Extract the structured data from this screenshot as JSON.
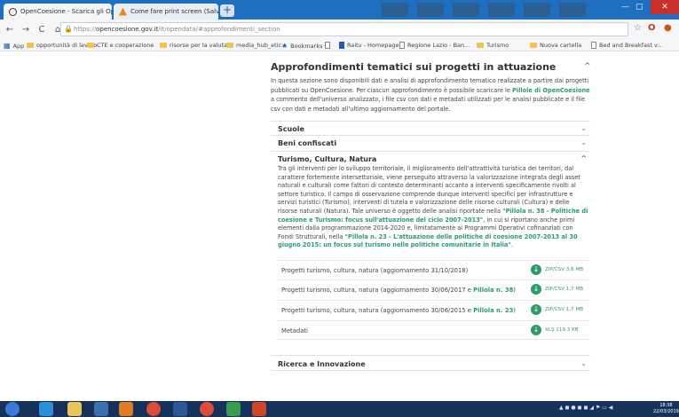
{
  "tabs": [
    {
      "title": "OpenCoesione - Scarica gli Ope"
    },
    {
      "title": "Come fare print screen (Salvatore"
    }
  ],
  "address_bar": {
    "secure_prefix": "https://",
    "domain": "opencoesione.gov.it",
    "path": "/it/opendata/#approfondimenti_section"
  },
  "bookmarks": [
    {
      "label": "App",
      "icon": "apps-icon"
    },
    {
      "label": "opportunità di lavoro",
      "icon": "folder-icon"
    },
    {
      "label": "CTE e cooperazione",
      "icon": "folder-icon"
    },
    {
      "label": "risorse per la valuta...",
      "icon": "folder-icon"
    },
    {
      "label": "media_hub_etic...",
      "icon": "folder-icon"
    },
    {
      "label": "Bookmarks",
      "icon": "star-icon"
    },
    {
      "label": "Raitv - Homepage",
      "icon": "page-icon"
    },
    {
      "label": "Regione Lazio - Ban...",
      "icon": "page-icon"
    },
    {
      "label": "Turismo",
      "icon": "folder-icon"
    },
    {
      "label": "Nuova cartella",
      "icon": "folder-icon"
    },
    {
      "label": "Bed and Breakfast v...",
      "icon": "page-icon"
    }
  ],
  "section": {
    "title": "Approfondimenti tematici sui progetti in attuazione",
    "intro_1": "In questa sezione sono disponibili dati e analisi di approfondimento tematico realizzate a partire dai progetti pubblicati su OpenCoesione. Per ciascun approfondimento è possibile scaricare le ",
    "intro_link": "Pillole di OpenCoesione",
    "intro_2": " a commento dell'universo analizzato, i file csv con dati e metadati utilizzati per le analisi pubblicate e il file csv con dati e metadati all'ultimo aggiornamento del portale."
  },
  "accordion": [
    {
      "label": "Scuole"
    },
    {
      "label": "Beni confiscati"
    },
    {
      "label": "Turismo, Cultura, Natura"
    },
    {
      "label": "Ricerca e Innovazione"
    }
  ],
  "turismo": {
    "body_1": "Tra gli interventi per lo sviluppo territoriale, il miglioramento dell'attrattività turistica dei territori, dal carattere fortemente intersettoriale, viene perseguito attraverso la valorizzazione integrata degli asset naturali e culturali come fattori di contesto determinanti accanto a interventi specificamente rivolti al settore turistico. Il campo di osservazione comprende dunque interventi specifici per infrastrutture e servizi turistici (Turismo), interventi di tutela e valorizzazione delle risorse culturali (Cultura) e delle risorse naturali (Natura). Tale universo è oggetto delle analisi riportate nella ",
    "link_1": "\"Pillola n. 38 - Politiche di coesione e Turismo: focus sull'attuazione del ciclo 2007-2013\"",
    "body_2": ", in cui si riportano anche primi elementi dalla programmazione 2014-2020 e, limitatamente ai Programmi Operativi cofinanziati con Fondi Strutturali, nella ",
    "link_2": "\"Pillola n. 23 - L'attuazione delle politiche di coesione 2007-2013 al 30 giugno 2015: un focus sul turismo nelle politiche comunitarie in Italia\"",
    "body_3": "."
  },
  "downloads": [
    {
      "label": "Progetti turismo, cultura, natura (aggiornamento 31/10/2018)",
      "link": "",
      "file": "ZIP/CSV 3,6 MB"
    },
    {
      "label": "Progetti turismo, cultura, natura (aggiornamento 30/06/2017 e ",
      "link": "Pillola n. 38",
      "suffix": ")",
      "file": "ZIP/CSV 1,7 MB"
    },
    {
      "label": "Progetti turismo, cultura, natura (aggiornamento 30/06/2015 e ",
      "link": "Pillola n. 23",
      "suffix": ")",
      "file": "ZIP/CSV 1,7 MB"
    },
    {
      "label": "Metadati",
      "link": "",
      "file": "XLS 119,3 KB"
    }
  ],
  "taskbar": {
    "time": "18:38",
    "date": "22/03/2019"
  },
  "colors": {
    "accent_green": "#2e9b6a",
    "taskbar": "#17325a",
    "tab_strip": "#1e6fbf"
  }
}
